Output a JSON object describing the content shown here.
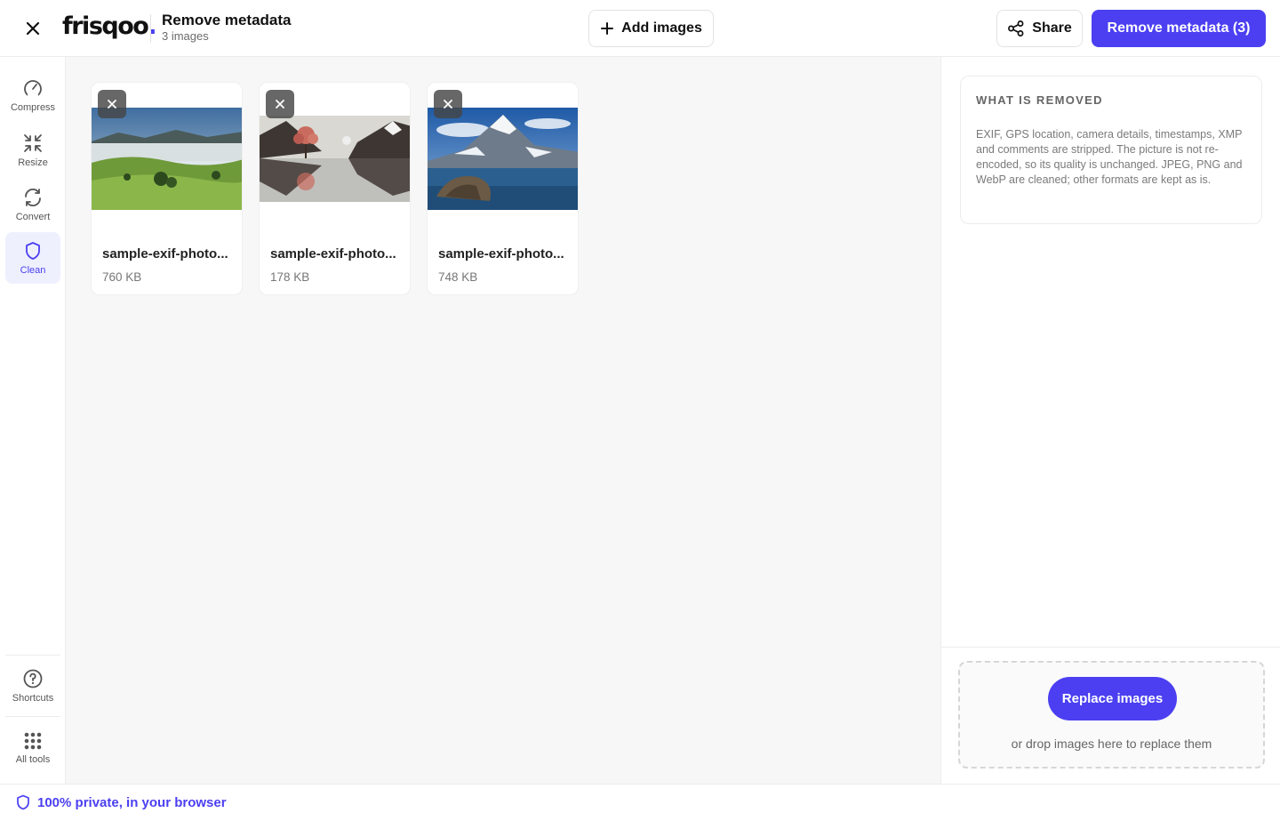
{
  "header": {
    "logo_text": "frisqoo",
    "logo_dot": ".",
    "title": "Remove metadata",
    "subtitle": "3 images",
    "add_images_label": "Add images",
    "share_label": "Share",
    "primary_label": "Remove metadata (3)",
    "accent_color": "#4b3ff1"
  },
  "sidebar": {
    "items": [
      {
        "label": "Compress",
        "icon": "gauge-icon"
      },
      {
        "label": "Resize",
        "icon": "minimize-arrows-icon"
      },
      {
        "label": "Convert",
        "icon": "refresh-icon"
      },
      {
        "label": "Clean",
        "icon": "shield-icon",
        "active": true
      }
    ],
    "bottom_items": [
      {
        "label": "Shortcuts",
        "icon": "question-circle-icon"
      },
      {
        "label": "All tools",
        "icon": "grid-dots-icon"
      }
    ]
  },
  "images": [
    {
      "name": "sample-exif-photo...",
      "size": "760 KB",
      "scene": "foggy green hills landscape"
    },
    {
      "name": "sample-exif-photo...",
      "size": "178 KB",
      "scene": "pink tree and mountains reflected in lake"
    },
    {
      "name": "sample-exif-photo...",
      "size": "748 KB",
      "scene": "snowy mountain peak above a lake with rocks"
    }
  ],
  "info": {
    "title": "WHAT IS REMOVED",
    "text": "EXIF, GPS location, camera details, timestamps, XMP and comments are stripped. The picture is not re-encoded, so its quality is unchanged. JPEG, PNG and WebP are cleaned; other formats are kept as is."
  },
  "dropzone": {
    "button_label": "Replace images",
    "hint": "or drop images here to replace them"
  },
  "footer": {
    "privacy_text": "100% private, in your browser"
  }
}
